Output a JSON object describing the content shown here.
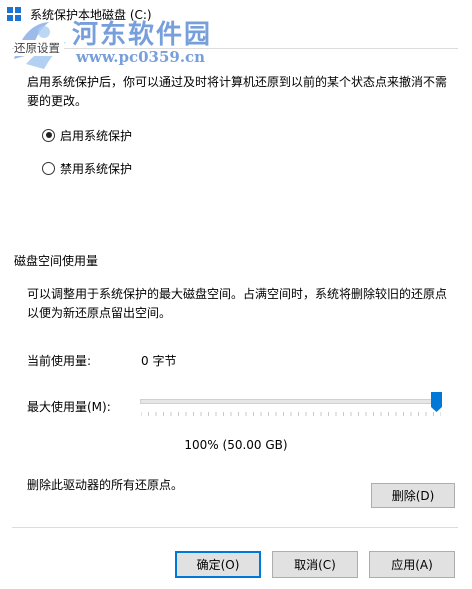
{
  "window": {
    "title": "系统保护本地磁盘 (C:)"
  },
  "watermark": {
    "brand": "河东软件园",
    "url": "www.pc0359.cn"
  },
  "restore_settings": {
    "group_label": "还原设置",
    "description": "启用系统保护后，你可以通过及时将计算机还原到以前的某个状态点来撤消不需要的更改。",
    "options": [
      {
        "label": "启用系统保护",
        "checked": true
      },
      {
        "label": "禁用系统保护",
        "checked": false
      }
    ]
  },
  "disk_usage": {
    "section_title": "磁盘空间使用量",
    "description": "可以调整用于系统保护的最大磁盘空间。占满空间时，系统将删除较旧的还原点以便为新还原点留出空间。",
    "current_label": "当前使用量:",
    "current_value": "0 字节",
    "max_label": "最大使用量(M):",
    "max_percent": 1.0,
    "max_text": "100% (50.00 GB)",
    "delete_text": "删除此驱动器的所有还原点。",
    "delete_button": "删除(D)"
  },
  "footer": {
    "ok": "确定(O)",
    "cancel": "取消(C)",
    "apply": "应用(A)"
  },
  "colors": {
    "accent": "#0078d7",
    "button_bg": "#e1e1e1",
    "button_border": "#adadad"
  }
}
